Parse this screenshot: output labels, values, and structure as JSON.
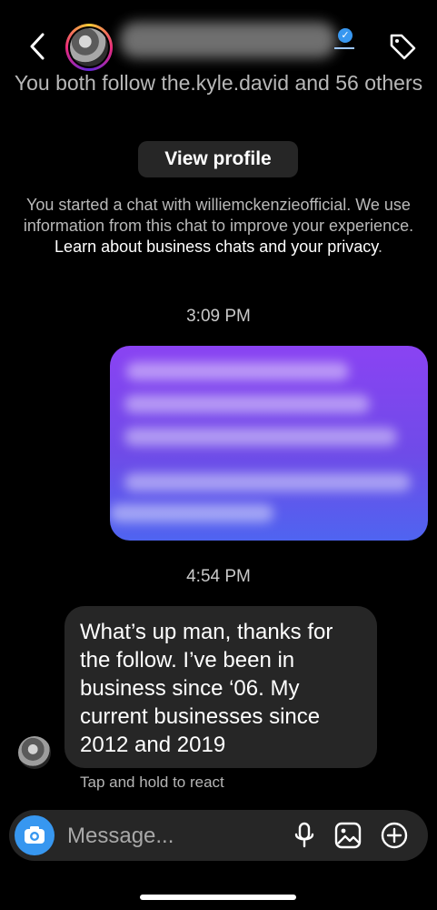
{
  "header": {
    "back_icon": "chevron-left-icon",
    "verified_icon": "verified-badge-icon",
    "tag_icon": "tag-icon",
    "avatar_ring_colors": [
      "#f9ce34",
      "#ee2a7b",
      "#6228d7"
    ]
  },
  "profile_intro": {
    "follow_text": "You both follow the.kyle.david and 56 others",
    "view_profile_label": "View profile",
    "disclaimer_text": "You started a chat with williemckenzieofficial. We use information from this chat to improve your experience. ",
    "disclaimer_link": "Learn about business chats and your privacy",
    "disclaimer_end": "."
  },
  "thread": {
    "timestamp_1": "3:09 PM",
    "timestamp_2": "4:54 PM",
    "received_message": "What’s up man, thanks for the follow.  I’ve been in business since ‘06.  My current businesses since 2012 and 2019",
    "tap_hint": "Tap and hold to react",
    "sent_bubble_colors": [
      "#8a43f3",
      "#4f64f0"
    ]
  },
  "composer": {
    "placeholder": "Message...",
    "camera_icon": "camera-icon",
    "microphone_icon": "microphone-icon",
    "gallery_icon": "gallery-icon",
    "add_icon": "plus-circle-icon",
    "accent": "#3797f0"
  }
}
